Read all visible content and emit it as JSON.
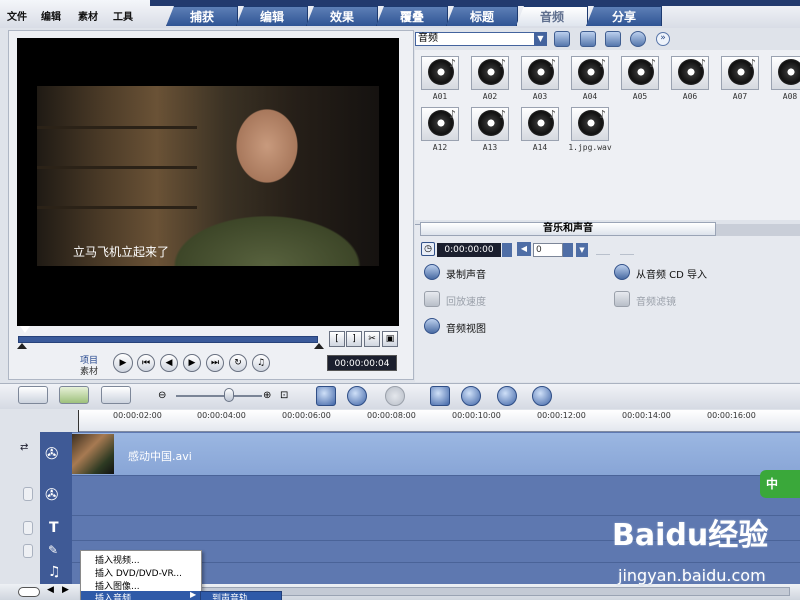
{
  "menu": [
    "文件",
    "编辑",
    "素材",
    "工具"
  ],
  "tabs": [
    "捕获",
    "编辑",
    "效果",
    "覆叠",
    "标题",
    "音频",
    "分享"
  ],
  "active_tab": "音频",
  "preview": {
    "subtitle": "立马飞机立起来了",
    "project_label": "项目",
    "clip_label": "素材",
    "timecode": "00:00:00:04"
  },
  "library": {
    "selected_category": "音频",
    "items": [
      "A01",
      "A02",
      "A03",
      "A04",
      "A05",
      "A06",
      "A07",
      "A08",
      "A12",
      "A13",
      "A14",
      "1.jpg.wav"
    ]
  },
  "options": {
    "title": "音乐和声音",
    "duration": "0:00:00:00",
    "volume": "0",
    "record_voice": "录制声音",
    "import_cd": "从音频 CD 导入",
    "playback_speed": "回放速度",
    "audio_filter": "音频滤镜",
    "audio_view": "音频视图"
  },
  "timeline": {
    "ruler": [
      "00:00:02:00",
      "00:00:04:00",
      "00:00:06:00",
      "00:00:08:00",
      "00:00:10:00",
      "00:00:12:00",
      "00:00:14:00",
      "00:00:16:00"
    ],
    "clip_name": "感动中国.avi"
  },
  "context_menu": {
    "items": [
      "插入视频...",
      "插入 DVD/DVD-VR...",
      "插入图像...",
      "插入音频"
    ],
    "submenu_item": "到声音轨"
  },
  "badge": "中",
  "watermark": {
    "logo": "Baidu经验",
    "url": "jingyan.baidu.com"
  }
}
